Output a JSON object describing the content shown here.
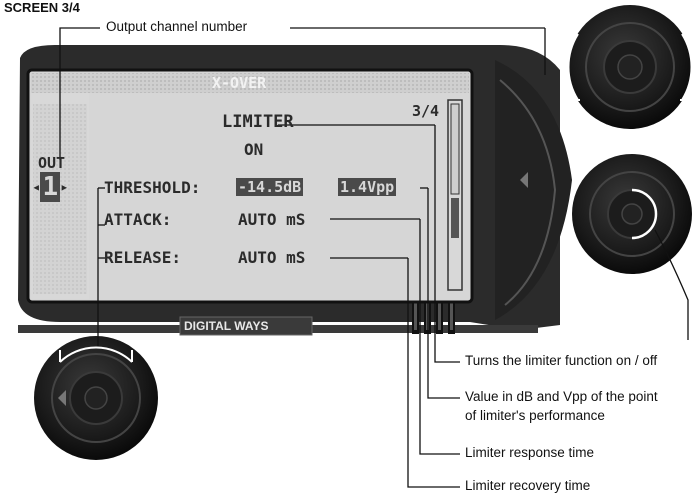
{
  "screen_label": "SCREEN 3/4",
  "lcd": {
    "header": "X-OVER",
    "title": "LIMITER",
    "page": "3/4",
    "status": "ON",
    "out_label": "OUT",
    "channel": "1",
    "threshold_label": "THRESHOLD:",
    "threshold_db": "-14.5dB",
    "threshold_vpp": "1.4Vpp",
    "attack_label": "ATTACK:",
    "attack_value": "AUTO mS",
    "release_label": "RELEASE:",
    "release_value": "AUTO mS",
    "brand": "DIGITAL WAYS"
  },
  "annotations": {
    "output_channel": "Output channel number",
    "on_off": "Turns the limiter function on / off",
    "value_line1": "Value in dB and Vpp of the point",
    "value_line2": "of limiter's performance",
    "response": "Limiter response time",
    "recovery": "Limiter recovery time"
  },
  "colors": {
    "device_body": "#2a2a2a",
    "lcd_background": "#d4d4d4",
    "lcd_text": "#2b2b2b"
  }
}
